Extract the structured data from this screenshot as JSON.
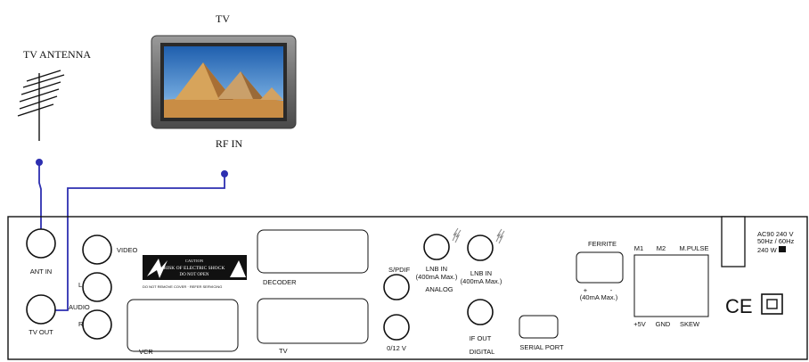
{
  "scene": {
    "tv_title": "TV",
    "antenna_title": "TV ANTENNA",
    "tv_rf_in": "RF IN"
  },
  "panel": {
    "ant_in": "ANT IN",
    "tv_out": "TV  OUT",
    "video": "VIDEO",
    "audio": "AUDIO",
    "audio_l": "L",
    "audio_r": "R",
    "warning_line1": "CAUTION",
    "warning_line2": "RISK OF ELECTRIC SHOCK",
    "warning_line3": "DO NOT OPEN",
    "warning_fine": "DO NOT REMOVE COVER · REFER SERVICING",
    "vcr": "VCR",
    "decoder": "DECODER",
    "tv_scart": "TV",
    "spdif": "S/PDIF",
    "v012": "0/12 V",
    "lnb1_line1": "LNB IN",
    "lnb1_line2": "(400mA Max.)",
    "analog": "ANALOG",
    "lnb2_line1": "LNB IN",
    "lnb2_line2": "(400mA Max.)",
    "if_out": "IF OUT",
    "digital": "DIGITAL",
    "serial_port": "SERIAL PORT",
    "ferrite": "FERRITE",
    "ferrite_plus": "+",
    "ferrite_minus": "-",
    "ferrite_max": "(40mA Max.)",
    "m1": "M1",
    "m2": "M2",
    "mpulse": "M.PULSE",
    "plus5v": "+5V",
    "gnd": "GND",
    "skew": "SKEW",
    "power_line1": "AC90   240 V",
    "power_line2": "50Hz / 60Hz",
    "power_line3": "240 W",
    "ce_mark": "CE"
  },
  "colors": {
    "wire": "#2d2fb0",
    "tv_frame": "#6e6e6e",
    "sky": "#2f77c4",
    "sand": "#d9a65a"
  },
  "icons": [
    "antenna-icon",
    "pyramid-scene-image",
    "lightning-bolt-icon",
    "ce-mark-icon",
    "double-insulation-icon"
  ]
}
